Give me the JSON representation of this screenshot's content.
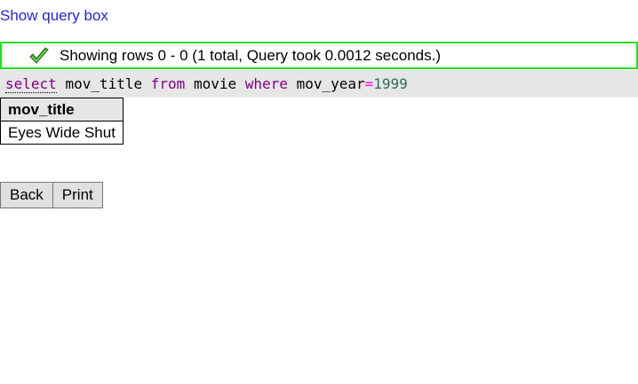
{
  "show_query_link": "Show query box",
  "status": {
    "message": "Showing rows 0 - 0 (1 total, Query took 0.0012 seconds.)",
    "icon": "check-icon",
    "border_color": "#22e11e"
  },
  "sql": {
    "select": "select",
    "col": "mov_title",
    "from": "from",
    "table": "movie",
    "where": "where",
    "field": "mov_year",
    "op": "=",
    "value": "1999"
  },
  "results": {
    "columns": [
      "mov_title"
    ],
    "rows": [
      [
        "Eyes Wide Shut"
      ]
    ]
  },
  "buttons": {
    "back": "Back",
    "print": "Print"
  }
}
